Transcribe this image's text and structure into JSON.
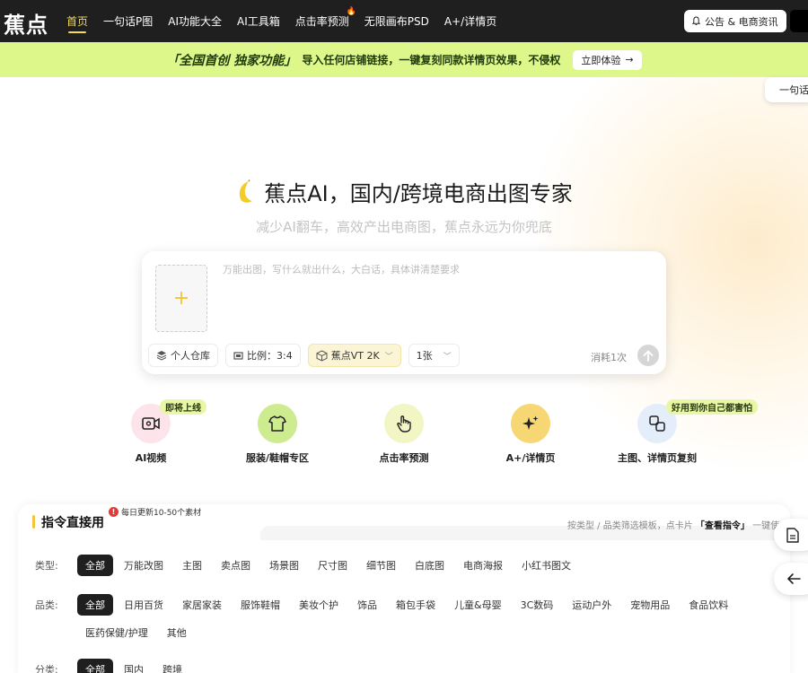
{
  "nav": {
    "logo": "蕉点",
    "items": [
      {
        "label": "首页",
        "active": true
      },
      {
        "label": "一句话P图"
      },
      {
        "label": "AI功能大全"
      },
      {
        "label": "AI工具箱"
      },
      {
        "label": "点击率预测",
        "hot": true
      },
      {
        "label": "无限画布PSD"
      },
      {
        "label": "A+/详情页"
      }
    ],
    "notice_label": "公告 & 电商资讯"
  },
  "banner": {
    "strong": "「全国首创 独家功能」",
    "text": "导入任何店铺链接，一键复刻同款详情页效果，不侵权",
    "button": "立即体验"
  },
  "side_tab": "一句话",
  "hero": {
    "title": "蕉点AI，国内/跨境电商出图专家",
    "subtitle": "减少AI翻车，高效产出电商图，蕉点永远为你兜底"
  },
  "prompt": {
    "placeholder": "万能出图，写什么就出什么，大白话，具体讲清楚要求",
    "repo": "个人仓库",
    "ratio": "比例：3:4",
    "model": "蕉点VT 2K",
    "count": "1张",
    "cost": "消耗1次"
  },
  "features": [
    {
      "label": "AI视频",
      "badge": "即将上线",
      "icon": "video-icon",
      "color": "#fde4ea"
    },
    {
      "label": "服装/鞋帽专区",
      "badge": "",
      "icon": "shirt-icon",
      "color": "#cdeb8f"
    },
    {
      "label": "点击率预测",
      "badge": "",
      "icon": "tap-icon",
      "color": "#f1f6c4"
    },
    {
      "label": "A+/详情页",
      "badge": "",
      "icon": "sparkle-icon",
      "color": "#f7d774"
    },
    {
      "label": "主图、详情页复刻",
      "badge": "好用到你自己都害怕",
      "icon": "copy-icon",
      "color": "#e4eefb"
    }
  ],
  "panel": {
    "title": "指令直接用",
    "update_badge": "每日更新10-50个素材",
    "update_dot": "!",
    "hint_prefix": "按类型 / 品类筛选模板，点卡片",
    "hint_strong": "「查看指令」",
    "hint_suffix": "一键使",
    "type_label": "类型:",
    "types": [
      "全部",
      "万能改图",
      "主图",
      "卖点图",
      "场景图",
      "尺寸图",
      "细节图",
      "白底图",
      "电商海报",
      "小红书图文"
    ],
    "category_label": "品类:",
    "categories": [
      "全部",
      "日用百货",
      "家居家装",
      "服饰鞋帽",
      "美妆个护",
      "饰品",
      "箱包手袋",
      "儿童&母婴",
      "3C数码",
      "运动户外",
      "宠物用品",
      "食品饮料",
      "医药保健/护理",
      "其他"
    ],
    "region_label": "分类:",
    "regions": [
      "全部",
      "国内",
      "跨境"
    ]
  }
}
